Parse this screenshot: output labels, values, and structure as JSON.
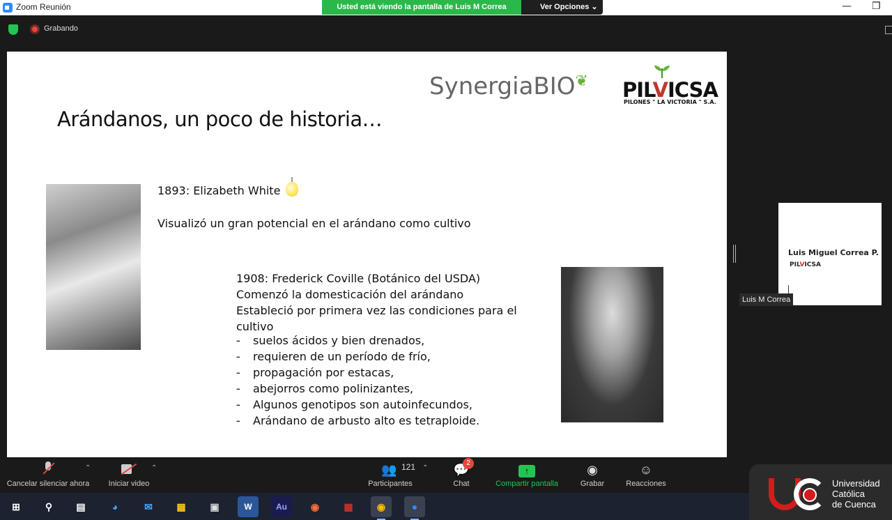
{
  "window": {
    "title": "Zoom Reunión",
    "share_banner": "Usted está viendo la pantalla de Luis M Correa",
    "view_options": "Ver Opciones",
    "minimize_glyph": "—",
    "restore_glyph": "❐"
  },
  "header": {
    "recording_label": "Grabando"
  },
  "slide": {
    "title": "Arándanos, un poco de historia…",
    "logo_synergia": "SynergiaBIO",
    "logo_pilvicsa": "PILVICSA",
    "logo_pilvicsa_sub": "PILONES \" LA VICTORIA \" S.A.",
    "line1": "1893: Elizabeth White",
    "line2": "Visualizó un gran potencial en el arándano como cultivo",
    "line3": "1908: Frederick Coville (Botánico del  USDA)",
    "line4": "Comenzó la domesticación del arándano",
    "line5": "Estableció por primera vez las condiciones para el",
    "line6": "cultivo",
    "bullets": [
      "suelos ácidos y bien drenados,",
      "requieren de un período de frío,",
      "propagación por estacas,",
      "abejorros como polinizantes,",
      "Algunos genotipos son autoinfecundos,",
      "Arándano de arbusto  alto es tetraploide."
    ]
  },
  "gallery": {
    "tile_name": "Luis Miguel Correa P.",
    "tile_mini_logo": "PILVICSA",
    "tile_label": "Luis M Correa"
  },
  "toolbar": {
    "mute_label": "Cancelar silenciar ahora",
    "video_label": "Iniciar video",
    "participants_label": "Participantes",
    "participants_count": "121",
    "chat_label": "Chat",
    "chat_badge": "2",
    "share_label": "Compartir pantalla",
    "record_label": "Grabar",
    "reactions_label": "Reacciones"
  },
  "university": {
    "line1": "Universidad",
    "line2": "Católica",
    "line3": "de Cuenca"
  },
  "taskbar": {
    "word_label": "W",
    "audition_label": "Au"
  },
  "colors": {
    "share_banner": "#2bb84a",
    "record_red": "#e8453c",
    "share_green": "#23c552",
    "university_red": "#d31c1c"
  }
}
